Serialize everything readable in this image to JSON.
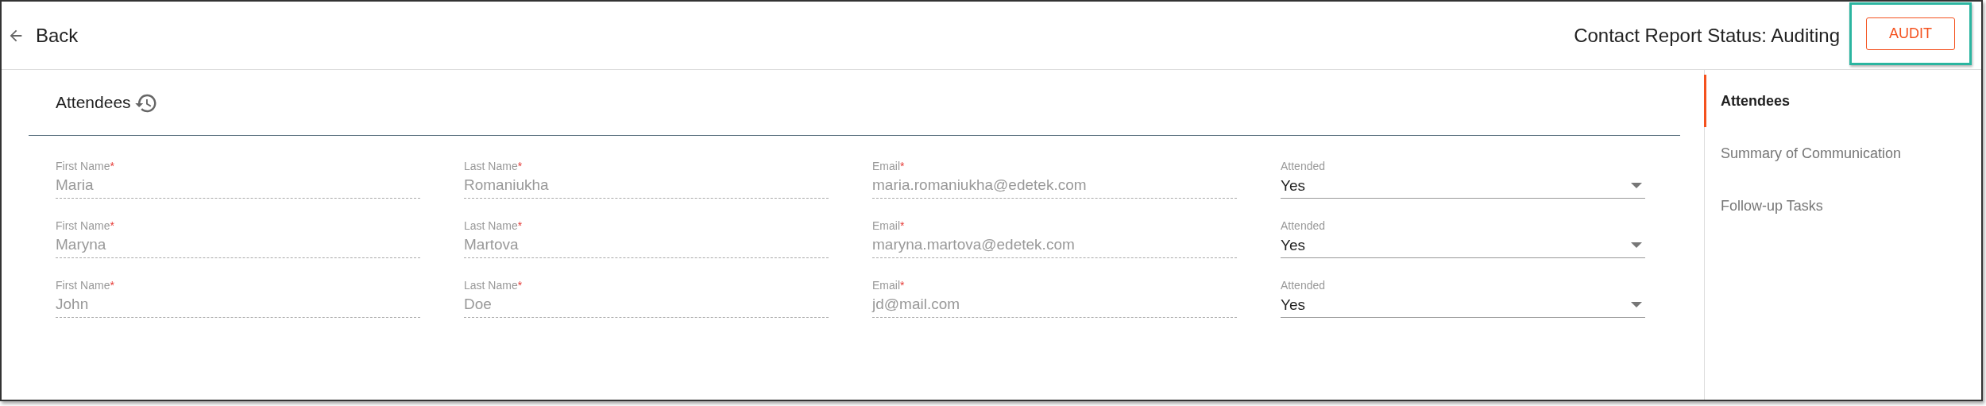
{
  "header": {
    "back_label": "Back",
    "status": "Contact Report Status: Auditing",
    "action_button": {
      "label": "AUDIT",
      "highlighted": true
    }
  },
  "section": {
    "title": "Attendees",
    "rows": [
      {
        "fields": [
          {
            "kind": "text",
            "label": "First Name",
            "required_mark": "*",
            "value": "Maria",
            "disabled": true
          },
          {
            "kind": "text",
            "label": "Last Name",
            "required_mark": "*",
            "value": "Romaniukha",
            "disabled": true
          },
          {
            "kind": "text",
            "label": "Email",
            "required_mark": "*",
            "value": "maria.romaniukha@edetek.com",
            "disabled": true
          },
          {
            "kind": "select",
            "label": "Attended",
            "value": "Yes",
            "disabled": false
          }
        ]
      },
      {
        "fields": [
          {
            "kind": "text",
            "label": "First Name",
            "required_mark": "*",
            "value": "Maryna",
            "disabled": true
          },
          {
            "kind": "text",
            "label": "Last Name",
            "required_mark": "*",
            "value": "Martova",
            "disabled": true
          },
          {
            "kind": "text",
            "label": "Email",
            "required_mark": "*",
            "value": "maryna.martova@edetek.com",
            "disabled": true
          },
          {
            "kind": "select",
            "label": "Attended",
            "value": "Yes",
            "disabled": false
          }
        ]
      },
      {
        "fields": [
          {
            "kind": "text",
            "label": "First Name",
            "required_mark": "*",
            "value": "John",
            "disabled": true
          },
          {
            "kind": "text",
            "label": "Last Name",
            "required_mark": "*",
            "value": "Doe",
            "disabled": true
          },
          {
            "kind": "text",
            "label": "Email",
            "required_mark": "*",
            "value": "jd@mail.com",
            "disabled": true
          },
          {
            "kind": "select",
            "label": "Attended",
            "value": "Yes",
            "disabled": false
          }
        ]
      }
    ]
  },
  "sidebar": {
    "items": [
      {
        "label": "Attendees",
        "selected": true
      },
      {
        "label": "Summary of Communication",
        "selected": false
      },
      {
        "label": "Follow-up Tasks",
        "selected": false
      }
    ]
  }
}
